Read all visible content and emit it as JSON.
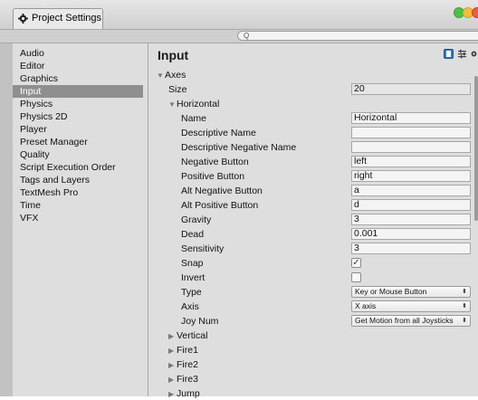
{
  "window": {
    "tab_label": "Project Settings",
    "search_placeholder": "Q"
  },
  "sidebar": {
    "items": [
      {
        "label": "Audio",
        "selected": false
      },
      {
        "label": "Editor",
        "selected": false
      },
      {
        "label": "Graphics",
        "selected": false
      },
      {
        "label": "Input",
        "selected": true
      },
      {
        "label": "Physics",
        "selected": false
      },
      {
        "label": "Physics 2D",
        "selected": false
      },
      {
        "label": "Player",
        "selected": false
      },
      {
        "label": "Preset Manager",
        "selected": false
      },
      {
        "label": "Quality",
        "selected": false
      },
      {
        "label": "Script Execution Order",
        "selected": false
      },
      {
        "label": "Tags and Layers",
        "selected": false
      },
      {
        "label": "TextMesh Pro",
        "selected": false
      },
      {
        "label": "Time",
        "selected": false
      },
      {
        "label": "VFX",
        "selected": false
      }
    ]
  },
  "main": {
    "title": "Input",
    "axes_label": "Axes",
    "size_label": "Size",
    "size_value": "20",
    "horizontal_label": "Horizontal",
    "fields": [
      {
        "label": "Name",
        "value": "Horizontal"
      },
      {
        "label": "Descriptive Name",
        "value": ""
      },
      {
        "label": "Descriptive Negative Name",
        "value": ""
      },
      {
        "label": "Negative Button",
        "value": "left"
      },
      {
        "label": "Positive Button",
        "value": "right"
      },
      {
        "label": "Alt Negative Button",
        "value": "a"
      },
      {
        "label": "Alt Positive Button",
        "value": "d"
      },
      {
        "label": "Gravity",
        "value": "3"
      },
      {
        "label": "Dead",
        "value": "0.001"
      },
      {
        "label": "Sensitivity",
        "value": "3"
      }
    ],
    "snap_label": "Snap",
    "snap_checked": true,
    "invert_label": "Invert",
    "invert_checked": false,
    "type_label": "Type",
    "type_value": "Key or Mouse Button",
    "axis_label": "Axis",
    "axis_value": "X axis",
    "joynum_label": "Joy Num",
    "joynum_value": "Get Motion from all Joysticks",
    "collapsed_axes": [
      "Vertical",
      "Fire1",
      "Fire2",
      "Fire3",
      "Jump"
    ],
    "check_mark": "✓"
  },
  "icons": {
    "tab": "gear-icon",
    "help": "help-book-icon",
    "preset": "preset-sliders-icon",
    "settings": "settings-gear-icon"
  },
  "colors": {
    "selected_bg": "#8f8f8f",
    "panel_bg": "#dedede"
  }
}
